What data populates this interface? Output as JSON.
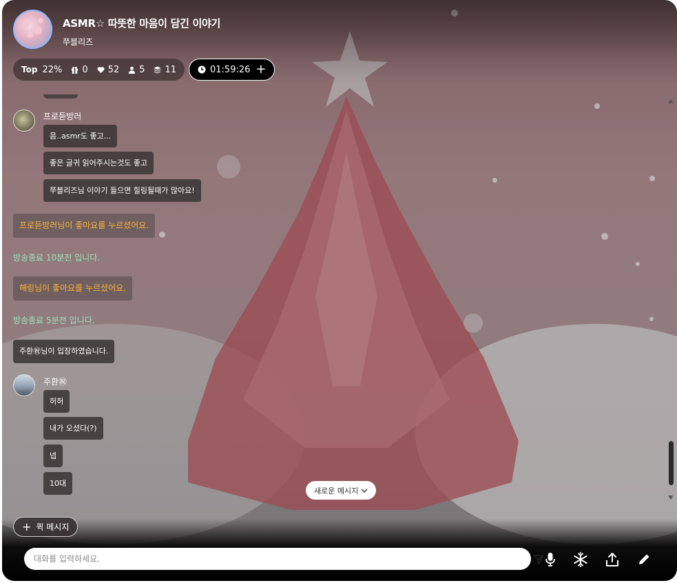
{
  "header": {
    "title": "ASMR☆ 따뜻한 마음이 담긴 이야기",
    "streamer": "쭈블리즈"
  },
  "stats": {
    "top_label": "Top",
    "top_percent": "22%",
    "gifts": "0",
    "likes": "52",
    "viewers": "5",
    "stacks": "11"
  },
  "timer": {
    "time": "01:59:26",
    "add_label": "+"
  },
  "chat": {
    "user1": {
      "name": "프로듣방러",
      "messages": [
        "음..asmr도 좋고...",
        "좋은 글귀 읽어주시는것도 좋고",
        "쭈블리즈님 이야기 들으면 힐링될때가 많아요!"
      ]
    },
    "like1": "프로듣방러님이 좋아요를 누르셨어요.",
    "notice1": "방송종료 10분전 입니다.",
    "like2": "해링님이 좋아요를 누르셨어요.",
    "notice2": "방송종료 5분전 입니다.",
    "enter": "주환㊗님이 입장하였습니다.",
    "user2": {
      "name": "주환㊗",
      "messages": [
        "허허",
        "내가 오셨다(?)",
        "넵",
        "10대"
      ]
    }
  },
  "new_message_label": "새로운 메시지",
  "quick_message_label": "퀵 메시지",
  "input": {
    "placeholder": "대화를 입력하세요.",
    "value": ""
  },
  "icons": [
    "gift-icon",
    "heart-icon",
    "person-icon",
    "layers-icon",
    "clock-icon",
    "send-icon",
    "mic-icon",
    "snowflake-icon",
    "share-icon",
    "pencil-icon"
  ]
}
